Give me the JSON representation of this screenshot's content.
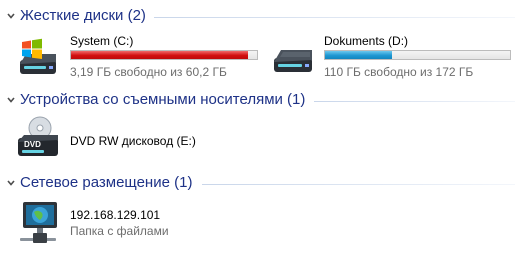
{
  "groups": [
    {
      "title": "Жесткие диски (2)",
      "items": [
        {
          "name": "System (C:)",
          "space": "3,19 ГБ свободно из 60,2 ГБ",
          "used_fraction": 0.95,
          "bar_color": "#d20f0f",
          "icon": "windows-hard-drive-icon"
        },
        {
          "name": "Dokuments (D:)",
          "space": "110 ГБ свободно из 172 ГБ",
          "used_fraction": 0.36,
          "bar_color": "#1e97d2",
          "icon": "hard-drive-icon"
        }
      ]
    },
    {
      "title": "Устройства со съемными носителями (1)",
      "items": [
        {
          "name": "DVD RW дисковод (E:)",
          "icon": "dvd-drive-icon",
          "icon_label": "DVD"
        }
      ]
    },
    {
      "title": "Сетевое размещение (1)",
      "items": [
        {
          "name": "192.168.129.101",
          "type": "Папка с файлами",
          "icon": "network-folder-icon"
        }
      ]
    }
  ],
  "colors": {
    "group_title": "#1e3287",
    "usage_critical": "#d20f0f",
    "usage_normal": "#1e97d2"
  }
}
